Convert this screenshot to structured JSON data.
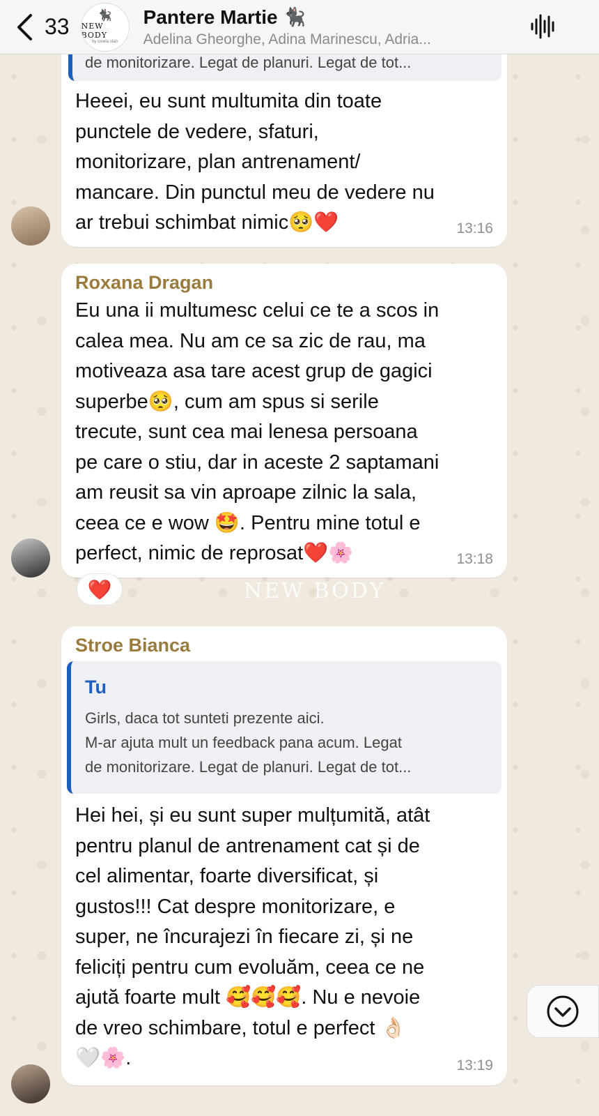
{
  "header": {
    "back_count": "33",
    "group_logo_text": "NEW BODY",
    "group_logo_sub": "by ionela stan",
    "title": "Pantere Martie",
    "title_emoji": "🐈‍⬛",
    "members": "Adelina Gheorghe, Adina Marinescu, Adria..."
  },
  "top_quote": {
    "text": "de monitorizare. Legat de planuri. Legat de tot..."
  },
  "msg1": {
    "lines": [
      "Heeei, eu sunt multumita din toate",
      "punctele de vedere, sfaturi,",
      "monitorizare, plan antrenament/",
      "mancare. Din punctul meu de vedere nu",
      "ar trebui schimbat nimic🥺❤️"
    ],
    "time": "13:16"
  },
  "msg2": {
    "sender": "Roxana Dragan",
    "lines": [
      "Eu una ii multumesc celui ce te a scos in",
      "calea mea. Nu am ce sa zic de rau, ma",
      "motiveaza asa tare acest grup de gagici",
      "superbe🥺, cum am spus si serile",
      "trecute, sunt cea mai lenesa persoana",
      "pe care o stiu, dar in aceste 2 saptamani",
      "am reusit sa vin aproape zilnic la sala,",
      "ceea ce e wow 🤩. Pentru mine totul e",
      "perfect, nimic de reprosat❤️🌸"
    ],
    "time": "13:18",
    "reaction": "❤️"
  },
  "watermark": "NEW BODY",
  "msg3": {
    "sender": "Stroe Bianca",
    "quote_author": "Tu",
    "quote_lines": [
      "Girls, daca tot sunteti prezente aici.",
      "M-ar ajuta mult un feedback pana acum. Legat",
      "de monitorizare. Legat de planuri. Legat de tot..."
    ],
    "lines": [
      "Hei hei, și eu sunt super mulțumită, atât",
      "pentru planul de antrenament cat și de",
      "cel alimentar, foarte diversificat, și",
      "gustos!!! Cat despre monitorizare, e",
      "super, ne încurajezi în fiecare zi, și ne",
      "feliciți pentru cum evoluăm, ceea ce ne",
      "ajută foarte mult 🥰🥰🥰. Nu e nevoie",
      "de vreo schimbare, totul e perfect 👌🏻",
      "🤍🌸."
    ],
    "time": "13:19"
  },
  "colors": {
    "sender_name": "#9a7b3d",
    "quote_accent": "#1d5fbf",
    "bubble": "#ffffff",
    "chat_background": "#efe9df"
  },
  "icons": [
    "back-chevron-icon",
    "voice-wave-icon",
    "scroll-down-icon"
  ]
}
